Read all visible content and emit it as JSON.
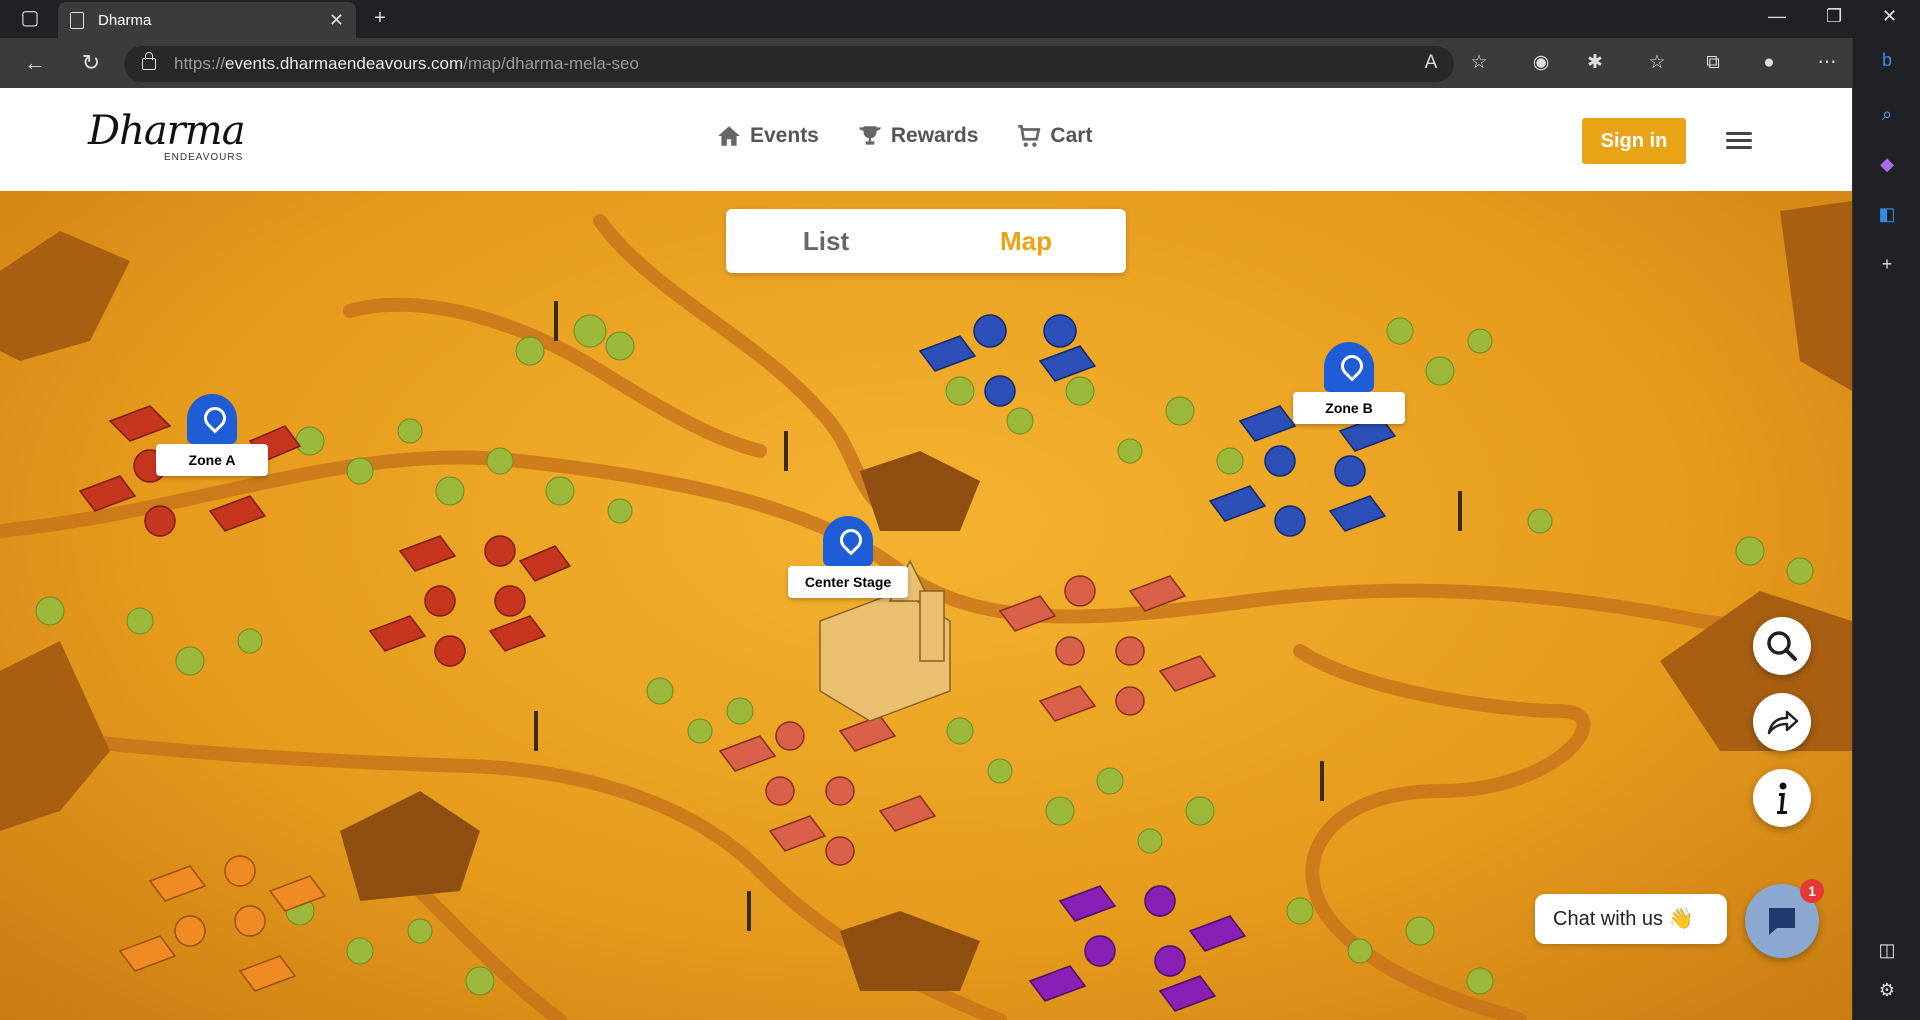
{
  "browser": {
    "tab_title": "Dharma",
    "url_scheme": "https://",
    "url_host": "events.dharmaendeavours.com",
    "url_path": "/map/dharma-mela-seo"
  },
  "header": {
    "logo_text": "Dharma",
    "logo_sub": "ENDEAVOURS",
    "nav": [
      {
        "label": "Events",
        "icon": "home-icon"
      },
      {
        "label": "Rewards",
        "icon": "trophy-icon"
      },
      {
        "label": "Cart",
        "icon": "cart-icon"
      }
    ],
    "signin_label": "Sign in"
  },
  "view_toggle": {
    "list_label": "List",
    "map_label": "Map",
    "active": "Map"
  },
  "zones": [
    {
      "label": "Zone A"
    },
    {
      "label": "Zone B"
    },
    {
      "label": "Center Stage"
    }
  ],
  "chat": {
    "bubble_text": "Chat with us 👋",
    "badge_count": "1"
  },
  "colors": {
    "accent": "#e8a317",
    "pin": "#1f5dd6",
    "map_ground": "#e8a020"
  }
}
